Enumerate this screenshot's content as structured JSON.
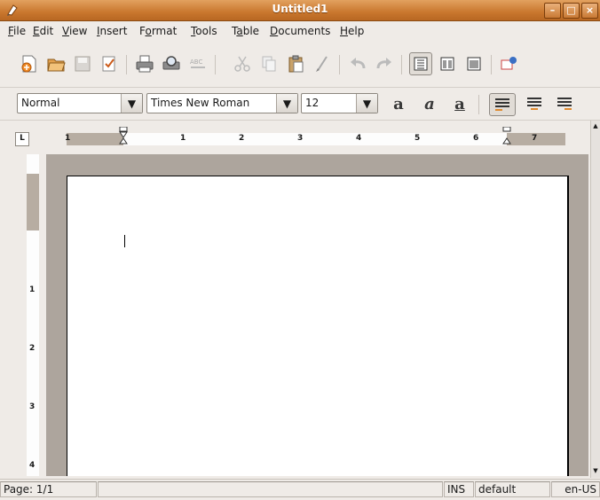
{
  "window": {
    "title": "Untitled1"
  },
  "menu": [
    {
      "label": "File",
      "u": "F",
      "rest": "ile"
    },
    {
      "label": "Edit",
      "u": "E",
      "rest": "dit"
    },
    {
      "label": "View",
      "u": "V",
      "rest": "iew"
    },
    {
      "label": "Insert",
      "u": "I",
      "rest": "nsert"
    },
    {
      "label": "Format",
      "pre": "F",
      "u": "o",
      "rest": "rmat"
    },
    {
      "label": "Tools",
      "u": "T",
      "rest": "ools"
    },
    {
      "label": "Table",
      "pre": "T",
      "u": "a",
      "rest": "ble"
    },
    {
      "label": "Documents",
      "u": "D",
      "rest": "ocuments"
    },
    {
      "label": "Help",
      "u": "H",
      "rest": "elp"
    }
  ],
  "format_bar": {
    "style": "Normal",
    "font": "Times New Roman",
    "size": "12"
  },
  "ruler": {
    "numbers": [
      "1",
      "1",
      "2",
      "3",
      "4",
      "5",
      "6",
      "7"
    ],
    "vnumbers": [
      "1",
      "2",
      "3",
      "4"
    ]
  },
  "status": {
    "page": "Page: 1/1",
    "mode": "INS",
    "style": "default",
    "lang": "en-US"
  },
  "colors": {
    "titlebar": "#c9772e",
    "doc_bg": "#ada59d",
    "accent": "#e08a2f"
  }
}
